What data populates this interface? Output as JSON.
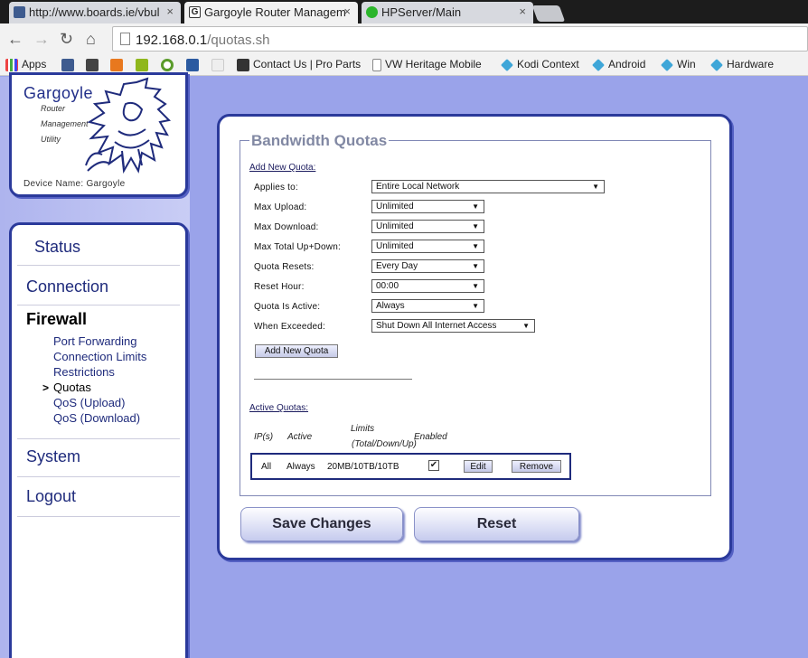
{
  "browser": {
    "tabs": [
      {
        "title": "http://www.boards.ie/vbul",
        "close": "×"
      },
      {
        "title": "Gargoyle Router Managem",
        "close": "×"
      },
      {
        "title": "HPServer/Main",
        "close": "×"
      }
    ],
    "url_host": "192.168.0.1",
    "url_path": "/quotas.sh",
    "nav_icons": {
      "back": "←",
      "forward": "→",
      "reload": "↻",
      "home": "⌂"
    },
    "bookmarks": [
      "Apps",
      "Contact Us | Pro Parts",
      "VW Heritage Mobile",
      "Kodi Context",
      "Android",
      "Win",
      "Hardware"
    ]
  },
  "logo": {
    "title": "Gargoyle",
    "sub1": "Router",
    "sub2": "Management",
    "sub3": "Utility",
    "device": "Device Name: Gargoyle"
  },
  "nav": {
    "status": "Status",
    "connection": "Connection",
    "firewall": "Firewall",
    "firewall_items": [
      "Port Forwarding",
      "Connection Limits",
      "Restrictions",
      "Quotas",
      "QoS (Upload)",
      "QoS (Download)"
    ],
    "current_marker": ">",
    "system": "System",
    "logout": "Logout"
  },
  "quotas": {
    "legend": "Bandwidth Quotas",
    "add_heading": "Add New Quota:",
    "fields": [
      {
        "label": "Applies to:",
        "value": "Entire Local Network"
      },
      {
        "label": "Max Upload:",
        "value": "Unlimited"
      },
      {
        "label": "Max Download:",
        "value": "Unlimited"
      },
      {
        "label": "Max Total Up+Down:",
        "value": "Unlimited"
      },
      {
        "label": "Quota Resets:",
        "value": "Every Day"
      },
      {
        "label": "Reset Hour:",
        "value": "00:00"
      },
      {
        "label": "Quota Is Active:",
        "value": "Always"
      },
      {
        "label": "When Exceeded:",
        "value": "Shut Down All Internet Access"
      }
    ],
    "add_button": "Add New Quota",
    "active_heading": "Active Quotas:",
    "columns": {
      "ips": "IP(s)",
      "active": "Active",
      "limits1": "Limits",
      "limits2": "(Total/Down/Up)",
      "enabled": "Enabled"
    },
    "row": {
      "ips": "All",
      "active": "Always",
      "limits": "20MB/10TB/10TB",
      "enabled_mark": "✔",
      "edit": "Edit",
      "remove": "Remove"
    }
  },
  "actions": {
    "save": "Save Changes",
    "reset": "Reset"
  }
}
